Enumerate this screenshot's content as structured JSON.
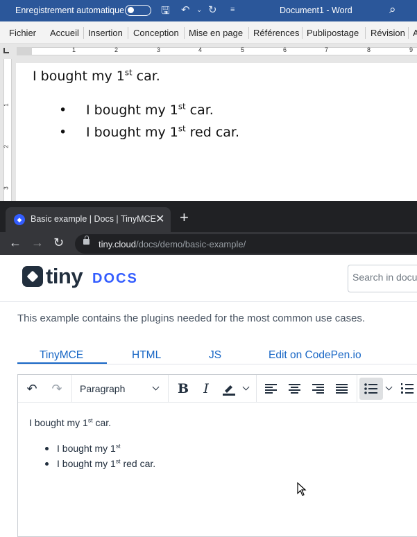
{
  "word": {
    "autosave_label": "Enregistrement automatique",
    "doc_title": "Document1  -  Word",
    "ribbon_tabs": [
      "Fichier",
      "Accueil",
      "Insertion",
      "Conception",
      "Mise en page",
      "Références",
      "Publipostage",
      "Révision",
      "A"
    ],
    "ruler_numbers": [
      "1",
      "2",
      "3",
      "4",
      "5",
      "6",
      "7",
      "8",
      "9"
    ],
    "vruler_numbers": [
      "1",
      "2",
      "3"
    ],
    "paragraph": {
      "text": "I bought my 1",
      "sup": "st",
      "tail": " car."
    },
    "bullets": [
      {
        "text": "I bought my 1",
        "sup": "st",
        "tail": " car."
      },
      {
        "text": "I bought my 1",
        "sup": "st",
        "tail": " red car."
      }
    ],
    "colors": {
      "titlebar": "#2b579a"
    }
  },
  "chrome": {
    "tab_title": "Basic example | Docs | TinyMCE",
    "url_host": "tiny.cloud",
    "url_path": "/docs/demo/basic-example/"
  },
  "tiny": {
    "wordmark": "tiny",
    "docs_label": "DOCS",
    "search_placeholder": "Search in docu",
    "description": "This example contains the plugins needed for the most common use cases.",
    "demo_tabs": [
      "TinyMCE",
      "HTML",
      "JS",
      "Edit on CodePen.io"
    ],
    "active_tab": "TinyMCE",
    "block_format": "Paragraph",
    "content": {
      "paragraph": {
        "text": "I bought my 1",
        "sup": "st",
        "tail": " car."
      },
      "list": [
        {
          "text": "I bought my 1",
          "sup": "st",
          "tail": ""
        },
        {
          "text": "I bought my 1",
          "sup": "st",
          "tail": " red car."
        }
      ]
    },
    "colors": {
      "brand_dark": "#222f3e",
      "brand_blue": "#335dff",
      "link": "#1766c5"
    }
  }
}
